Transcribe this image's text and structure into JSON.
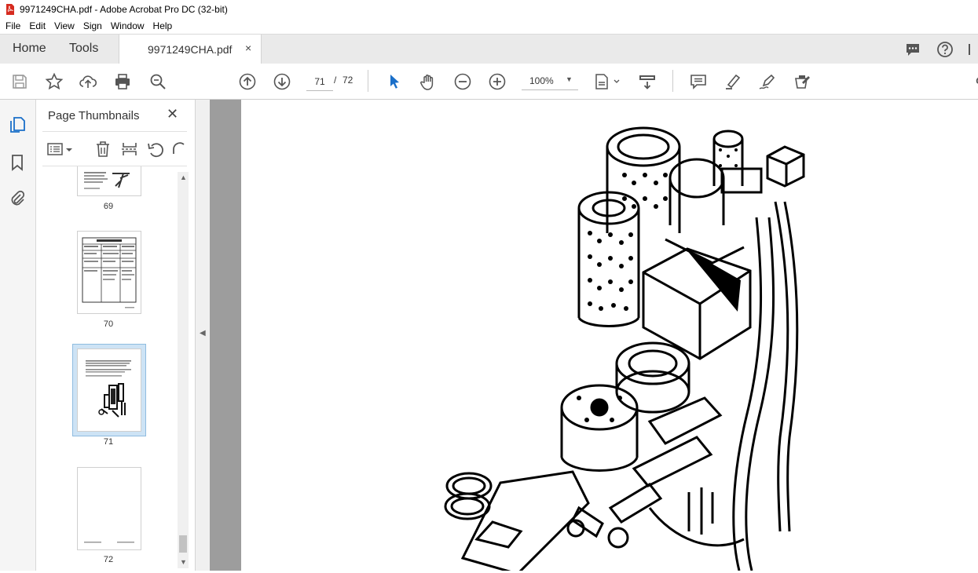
{
  "window": {
    "title": "9971249CHA.pdf - Adobe Acrobat Pro DC (32-bit)"
  },
  "menu": [
    "File",
    "Edit",
    "View",
    "Sign",
    "Window",
    "Help"
  ],
  "tabs": {
    "home": "Home",
    "tools": "Tools",
    "document": "9971249CHA.pdf",
    "close": "×"
  },
  "toolbar": {
    "current_page": "71",
    "page_separator": "/",
    "total_pages": "72",
    "zoom": "100%"
  },
  "thumbnail_panel": {
    "title": "Page Thumbnails",
    "close": "✕",
    "pages": [
      {
        "label": "69"
      },
      {
        "label": "70"
      },
      {
        "label": "71",
        "selected": true
      },
      {
        "label": "72"
      }
    ]
  },
  "colors": {
    "accent": "#1a6fc9",
    "selection": "#cde3f5",
    "gray_area": "#9d9d9d"
  }
}
